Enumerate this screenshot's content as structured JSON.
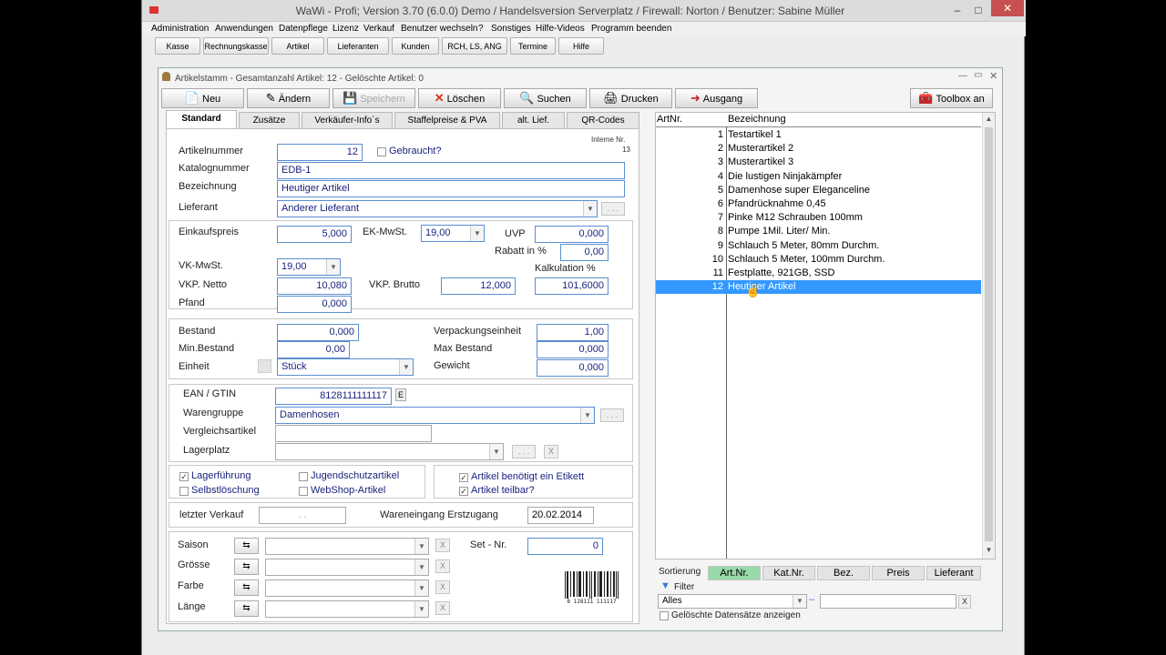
{
  "app_title": "WaWi - Profi; Version 3.70 (6.0.0) Demo / Handelsversion Serverplatz / Firewall: Norton / Benutzer: Sabine Müller",
  "window_controls": {
    "minimize": "–",
    "maximize": "□",
    "close": "✕"
  },
  "menu": [
    "Administration",
    "Anwendungen",
    "Datenpflege",
    "Lizenz",
    "Verkauf",
    "Benutzer wechseln",
    "?",
    "Sonstiges",
    "Hilfe-Videos",
    "Programm beenden"
  ],
  "quickbar": [
    "Kasse",
    "Rechnungskasse",
    "Artikel",
    "Lieferanten",
    "Kunden",
    "RCH, LS, ANG",
    "Termine",
    "Hilfe"
  ],
  "child_title": "Artikelstamm - Gesamtanzahl Artikel: 12 - Gelöschte Artikel: 0",
  "toolbar": {
    "neu": "Neu",
    "aendern": "Ändern",
    "speichern": "Speichern",
    "loeschen": "Löschen",
    "suchen": "Suchen",
    "drucken": "Drucken",
    "ausgang": "Ausgang",
    "toolbox": "Toolbox an"
  },
  "tabs": [
    "Standard",
    "Zusätze",
    "Verkäufer-Info´s",
    "Staffelpreise & PVA",
    "alt. Lief.",
    "QR-Codes"
  ],
  "interne_nr": {
    "label": "Interne Nr.",
    "value": "13"
  },
  "article": {
    "artikelnummer_label": "Artikelnummer",
    "artikelnummer": "12",
    "gebraucht_label": "Gebraucht?",
    "katalognummer_label": "Katalognummer",
    "katalognummer": "EDB-1",
    "bezeichnung_label": "Bezeichnung",
    "bezeichnung": "Heutiger Artikel",
    "lieferant_label": "Lieferant",
    "lieferant": "Anderer Lieferant",
    "lieferant_dots": ". . ."
  },
  "prices": {
    "einkaufspreis_label": "Einkaufspreis",
    "einkaufspreis": "5,000",
    "ek_mwst_label": "EK-MwSt.",
    "ek_mwst": "19,00",
    "uvp_label": "UVP",
    "uvp": "0,000",
    "rabatt_label": "Rabatt in %",
    "rabatt": "0,00",
    "vk_mwst_label": "VK-MwSt.",
    "vk_mwst": "19,00",
    "kalkulation_label": "Kalkulation %",
    "vkp_netto_label": "VKP. Netto",
    "vkp_netto": "10,080",
    "vkp_brutto_label": "VKP. Brutto",
    "vkp_brutto": "12,000",
    "kalkulation": "101,6000",
    "pfand_label": "Pfand",
    "pfand": "0,000"
  },
  "stock": {
    "bestand_label": "Bestand",
    "bestand": "0,000",
    "verpackung_label": "Verpackungseinheit",
    "verpackung": "1,00",
    "min_bestand_label": "Min.Bestand",
    "min_bestand": "0,00",
    "max_bestand_label": "Max Bestand",
    "max_bestand": "0,000",
    "einheit_label": "Einheit",
    "einheit": "Stück",
    "gewicht_label": "Gewicht",
    "gewicht": "0,000"
  },
  "ean": {
    "ean_label": "EAN / GTIN",
    "ean": "8128111111117",
    "ean_btn": "E",
    "warengruppe_label": "Warengruppe",
    "warengruppe": "Damenhosen",
    "warengruppe_dots": ". . .",
    "vergleich_label": "Vergleichsartikel",
    "lagerplatz_label": "Lagerplatz",
    "lagerplatz_dots": ". . .",
    "lagerplatz_x": "X"
  },
  "checks": {
    "lagerfuehrung": {
      "label": "Lagerführung",
      "checked": true
    },
    "selbstloeschung": {
      "label": "Selbstlöschung",
      "checked": false
    },
    "jugendschutz": {
      "label": "Jugendschutzartikel",
      "checked": false
    },
    "webshop": {
      "label": "WebShop-Artikel",
      "checked": false
    },
    "etikett": {
      "label": "Artikel benötigt ein Etikett",
      "checked": true
    },
    "teilbar": {
      "label": "Artikel teilbar?",
      "checked": true
    },
    "check_mark": "✓"
  },
  "sales": {
    "letzter_verkauf_label": "letzter Verkauf",
    "letzter_verkauf": ". .",
    "wareneingang_label": "Wareneingang Erstzugang",
    "wareneingang": "20.02.2014"
  },
  "variants": {
    "saison_label": "Saison",
    "groesse_label": "Grösse",
    "farbe_label": "Farbe",
    "laenge_label": "Länge",
    "set_nr_label": "Set - Nr.",
    "set_nr": "0",
    "x_label": "X",
    "barcode_text": "8 128111 111117"
  },
  "list": {
    "col_artnr": "ArtNr.",
    "col_bez": "Bezeichnung",
    "rows": [
      {
        "nr": "1",
        "bez": "Testartikel 1"
      },
      {
        "nr": "2",
        "bez": "Musterartikel 2"
      },
      {
        "nr": "3",
        "bez": "Musterartikel 3"
      },
      {
        "nr": "4",
        "bez": "Die lustigen Ninjakämpfer"
      },
      {
        "nr": "5",
        "bez": "Damenhose super Eleganceline"
      },
      {
        "nr": "6",
        "bez": "Pfandrücknahme 0,45"
      },
      {
        "nr": "7",
        "bez": "Pinke M12 Schrauben 100mm"
      },
      {
        "nr": "8",
        "bez": "Pumpe 1Mil. Liter/ Min."
      },
      {
        "nr": "9",
        "bez": "Schlauch 5 Meter, 80mm Durchm."
      },
      {
        "nr": "10",
        "bez": "Schlauch 5 Meter, 100mm Durchm."
      },
      {
        "nr": "11",
        "bez": "Festplatte, 921GB, SSD"
      },
      {
        "nr": "12",
        "bez": "Heutiger Artikel"
      }
    ],
    "selected_index": 11
  },
  "sorting": {
    "label": "Sortierung",
    "buttons": [
      "Art.Nr.",
      "Kat.Nr.",
      "Bez.",
      "Preis",
      "Lieferant"
    ],
    "active": 0
  },
  "filter": {
    "label": "Filter",
    "value": "Alles",
    "x": "X",
    "deleted_label": "Gelöschte Datensätze anzeigen"
  },
  "colors": {
    "selection": "#3399ff",
    "active_sort": "#99d9a8",
    "input_text": "#1a237e",
    "close_button": "#c75050"
  }
}
